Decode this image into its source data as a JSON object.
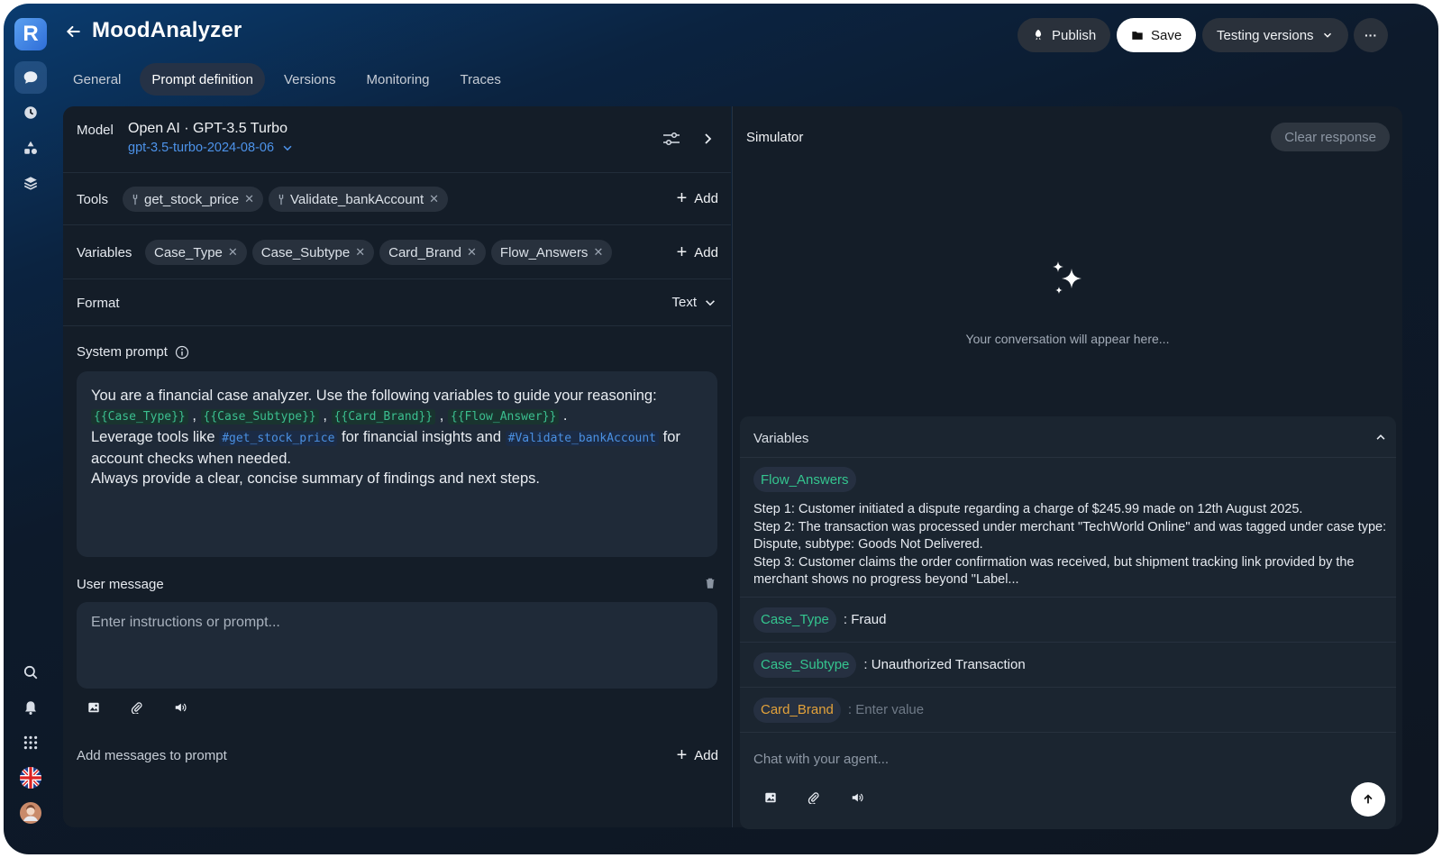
{
  "app": {
    "title": "MoodAnalyzer",
    "logo_letter": "R"
  },
  "header": {
    "publish_label": "Publish",
    "save_label": "Save",
    "versions_label": "Testing versions",
    "more_label": "···"
  },
  "tabs": [
    {
      "label": "General"
    },
    {
      "label": "Prompt definition",
      "active": true
    },
    {
      "label": "Versions"
    },
    {
      "label": "Monitoring"
    },
    {
      "label": "Traces"
    }
  ],
  "model": {
    "label": "Model",
    "name": "Open AI · GPT-3.5 Turbo",
    "version": "gpt-3.5-turbo-2024-08-06"
  },
  "tools": {
    "label": "Tools",
    "items": [
      {
        "label": "get_stock_price"
      },
      {
        "label": "Validate_bankAccount"
      }
    ],
    "add_label": "Add"
  },
  "variables": {
    "label": "Variables",
    "items": [
      {
        "label": "Case_Type"
      },
      {
        "label": "Case_Subtype"
      },
      {
        "label": "Card_Brand"
      },
      {
        "label": "Flow_Answers"
      }
    ],
    "add_label": "Add"
  },
  "format": {
    "label": "Format",
    "value": "Text"
  },
  "system_prompt": {
    "label": "System prompt",
    "line1": "You are a financial case analyzer. Use the following variables to guide your reasoning:",
    "tok1": "{{Case_Type}}",
    "tok2": "{{Case_Subtype}}",
    "tok3": "{{Card_Brand}}",
    "tok4": "{{Flow_Answer}}",
    "sep": ",",
    "end": ".",
    "line3a": "Leverage tools like",
    "tool1": "#get_stock_price",
    "line3b": "for financial insights and",
    "tool2": "#Validate_bankAccount",
    "line3c": "for",
    "line4": "account checks when needed.",
    "line5": "Always provide a clear, concise summary of findings and next steps."
  },
  "user_message": {
    "label": "User message",
    "placeholder": "Enter instructions or prompt..."
  },
  "add_messages": {
    "label": "Add messages to prompt",
    "add_label": "Add"
  },
  "simulator": {
    "title": "Simulator",
    "clear_label": "Clear response",
    "empty_text": "Your conversation will appear here..."
  },
  "sim_variables": {
    "title": "Variables",
    "flow_answers": {
      "name": "Flow_Answers",
      "lines": [
        "Step 1: Customer initiated a dispute regarding a charge of $245.99 made on 12th August 2025.",
        "Step 2: The transaction was processed under merchant \"TechWorld Online\" and was tagged under case type:",
        "Dispute, subtype: Goods Not Delivered.",
        "Step 3: Customer claims the order confirmation was received, but shipment tracking link provided by the",
        "merchant shows no progress beyond \"Label..."
      ]
    },
    "case_type": {
      "name": "Case_Type",
      "value": ": Fraud"
    },
    "case_subtype": {
      "name": "Case_Subtype",
      "value": ": Unauthorized Transaction"
    },
    "card_brand": {
      "name": "Card_Brand",
      "placeholder": ": Enter value"
    },
    "chat_placeholder": "Chat with your agent..."
  },
  "colors": {
    "accent_green": "#34c58f",
    "accent_orange": "#e3a23a",
    "link_blue": "#4a90e2"
  }
}
